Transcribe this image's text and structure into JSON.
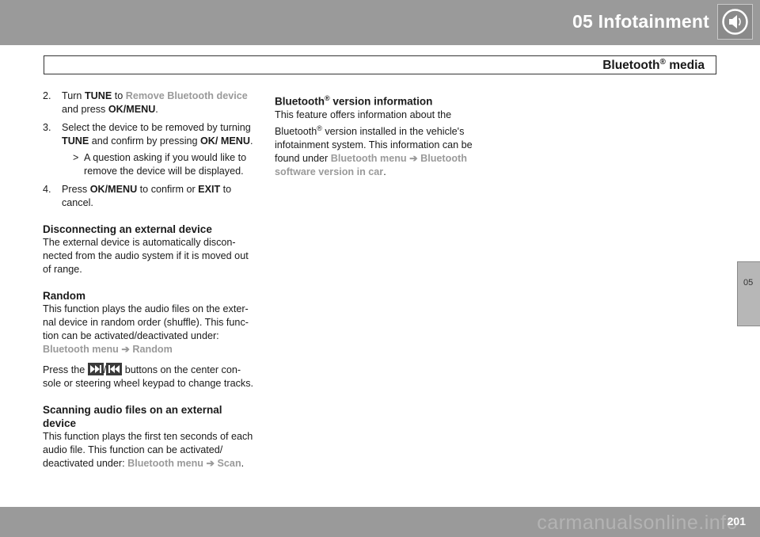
{
  "header": {
    "chapter_title": "05 Infotainment",
    "section_title": "Bluetooth",
    "section_title_sup": "®",
    "section_title_rest": " media",
    "icon": "speaker-icon"
  },
  "side_tab": {
    "label": "05"
  },
  "footer": {
    "page_number": "201",
    "watermark": "carmanualsonline.info"
  },
  "left_column": {
    "step2": {
      "num": "2.",
      "t1": "Turn ",
      "b1": "TUNE",
      "t2": " to ",
      "menu1": "Remove Bluetooth device",
      "t3": " and press ",
      "b2": "OK/MENU",
      "t4": "."
    },
    "step3": {
      "num": "3.",
      "t1": "Select the device to be removed by turning ",
      "b1": "TUNE",
      "t2": " and confirm by pressing ",
      "b2": "OK/ MENU",
      "t3": "."
    },
    "step3_sub": {
      "gt": ">",
      "text": "A question asking if you would like to remove the device will be displayed."
    },
    "step4": {
      "num": "4.",
      "t1": "Press ",
      "b1": "OK/MENU",
      "t2": " to confirm or ",
      "b2": "EXIT",
      "t3": " to cancel."
    },
    "disconnect_heading": "Disconnecting an external device",
    "disconnect_text": "The external device is automatically discon-nected from the audio system if it is moved out of range.",
    "random_heading": "Random",
    "random_text": "This function plays the audio files on the exter-nal device in random order (shuffle). This func-tion can be activated/deactivated under:",
    "random_menu1": "Bluetooth menu",
    "random_arrow": "➔",
    "random_menu2": "Random",
    "press_t1": "Press the ",
    "press_slash": "/",
    "press_t2": " buttons on the center con-sole or steering wheel keypad to change tracks.",
    "scan_heading": "Scanning audio files on an external device",
    "scan_text": "This function plays the first ten seconds of each audio file. This function can be activated/ deactivated under: ",
    "scan_menu1": "Bluetooth menu",
    "scan_arrow": "➔",
    "scan_menu2": "Scan",
    "scan_end": "."
  },
  "right_column": {
    "heading": "Bluetooth",
    "heading_sup": "®",
    "heading_rest": " version information",
    "t1": "This feature offers information about the Bluetooth",
    "t1_sup": "®",
    "t2": " version installed in the vehicle's infotainment system. This information can be found under ",
    "menu1": "Bluetooth menu",
    "arrow": "➔",
    "menu2": "Bluetooth software version in car",
    "end": "."
  }
}
